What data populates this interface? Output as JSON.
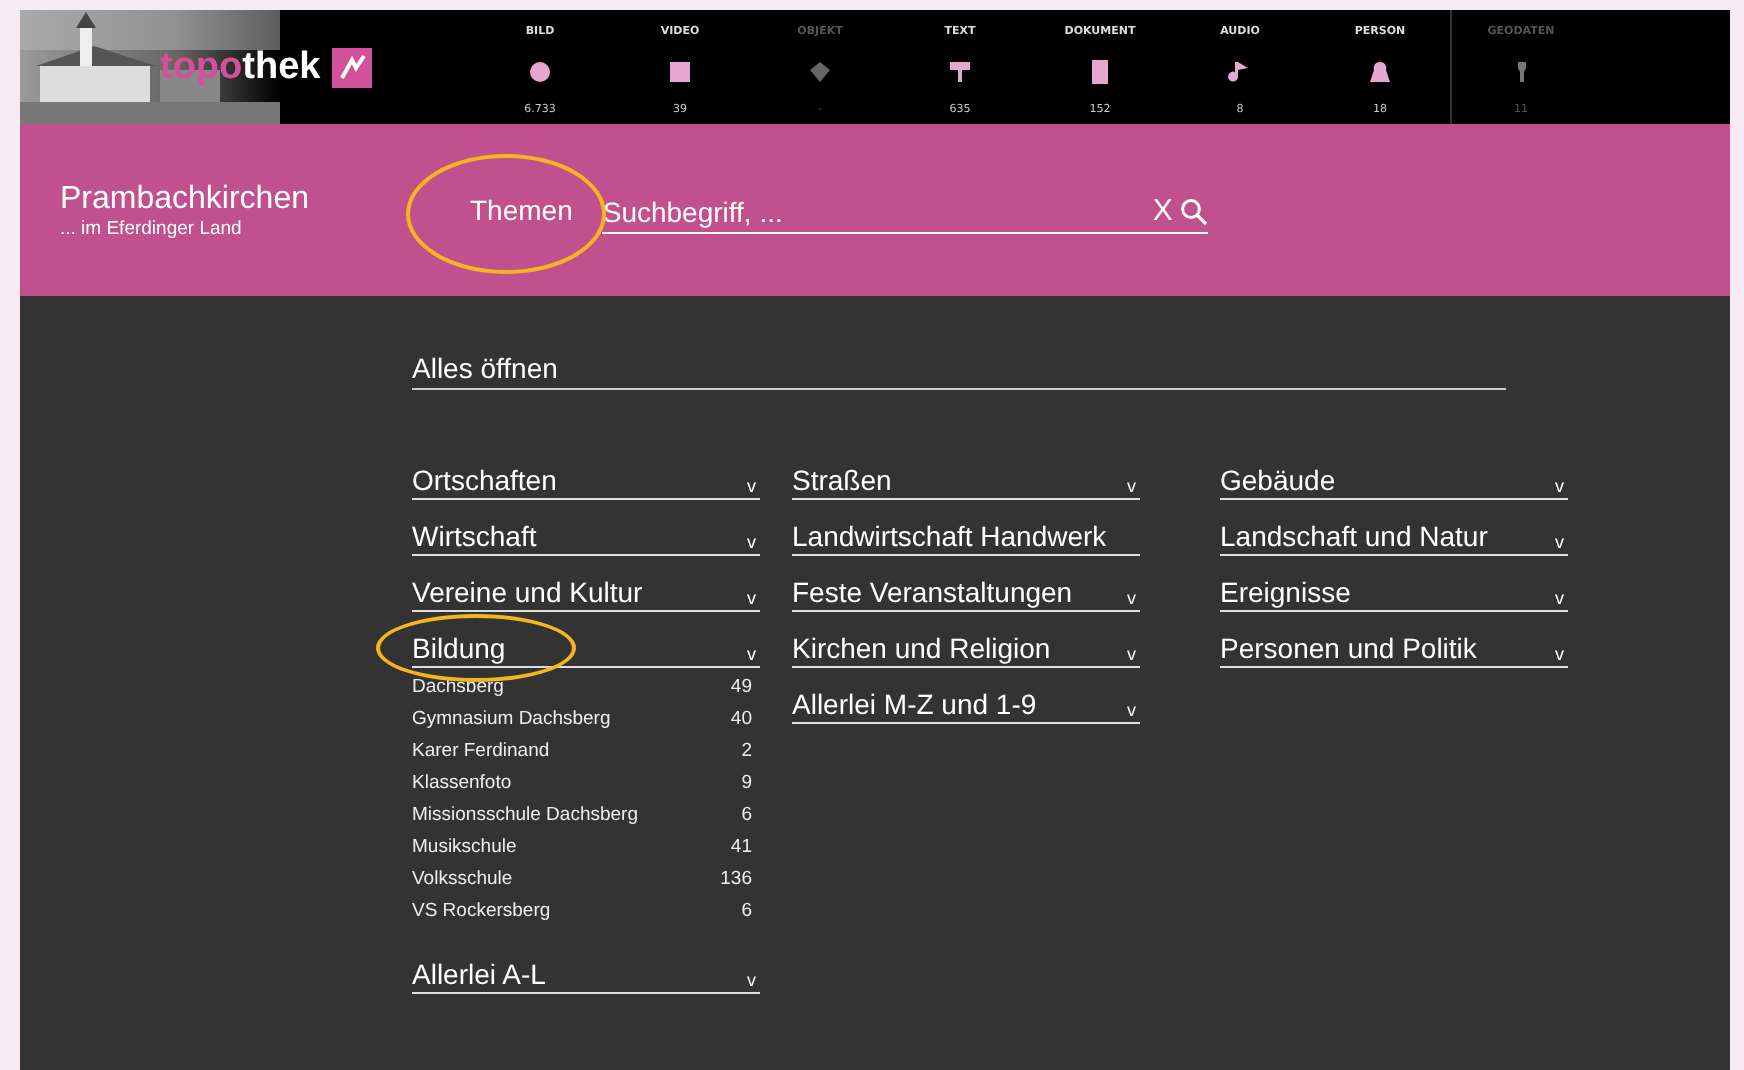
{
  "logo": {
    "part_1": "topo",
    "part_2": "thek"
  },
  "media_types": [
    {
      "label": "BILD",
      "count": "6.733",
      "disabled": false
    },
    {
      "label": "VIDEO",
      "count": "39",
      "disabled": false
    },
    {
      "label": "OBJEKT",
      "count": "-",
      "disabled": true
    },
    {
      "label": "TEXT",
      "count": "635",
      "disabled": false
    },
    {
      "label": "DOKUMENT",
      "count": "152",
      "disabled": false
    },
    {
      "label": "AUDIO",
      "count": "8",
      "disabled": false
    },
    {
      "label": "PERSON",
      "count": "18",
      "disabled": false
    },
    {
      "label": "GEODATEN",
      "count": "11",
      "disabled": true
    }
  ],
  "site": {
    "title": "Prambachkirchen",
    "subtitle": "... im Eferdinger Land"
  },
  "themes_button": {
    "label": "Themen",
    "highlighted": true
  },
  "search": {
    "placeholder": "Suchbegriff, ...",
    "clear": "X"
  },
  "open_all": "Alles öffnen",
  "columns": [
    [
      {
        "label": "Ortschaften",
        "toggle": "v",
        "expanded": false,
        "highlighted": false
      },
      {
        "label": "Wirtschaft",
        "toggle": "v",
        "expanded": false,
        "highlighted": false
      },
      {
        "label": "Vereine und Kultur",
        "toggle": "v",
        "expanded": false,
        "highlighted": false
      },
      {
        "label": "Bildung",
        "toggle": "v",
        "expanded": true,
        "highlighted": true,
        "children": [
          {
            "label": "Dachsberg",
            "count": "49"
          },
          {
            "label": "Gymnasium Dachsberg",
            "count": "40"
          },
          {
            "label": "Karer Ferdinand",
            "count": "2"
          },
          {
            "label": "Klassenfoto",
            "count": "9"
          },
          {
            "label": "Missionsschule Dachsberg",
            "count": "6"
          },
          {
            "label": "Musikschule",
            "count": "41"
          },
          {
            "label": "Volksschule",
            "count": "136"
          },
          {
            "label": "VS Rockersberg",
            "count": "6"
          }
        ]
      },
      {
        "label": "Allerlei A-L",
        "toggle": "v",
        "expanded": false,
        "highlighted": false
      }
    ],
    [
      {
        "label": "Straßen",
        "toggle": "v",
        "expanded": false,
        "highlighted": false
      },
      {
        "label": "Landwirtschaft Handwerk",
        "expanded": false,
        "highlighted": false
      },
      {
        "label": "Feste Veranstaltungen",
        "toggle": "v",
        "expanded": false,
        "highlighted": false
      },
      {
        "label": "Kirchen und Religion",
        "toggle": "v",
        "expanded": false,
        "highlighted": false
      },
      {
        "label": "Allerlei M-Z und 1-9",
        "toggle": "v",
        "expanded": false,
        "highlighted": false
      }
    ],
    [
      {
        "label": "Gebäude",
        "toggle": "v",
        "expanded": false,
        "highlighted": false
      },
      {
        "label": "Landschaft und Natur",
        "toggle": "v",
        "expanded": false,
        "highlighted": false
      },
      {
        "label": "Ereignisse",
        "toggle": "v",
        "expanded": false,
        "highlighted": false
      },
      {
        "label": "Personen und Politik",
        "toggle": "v",
        "expanded": false,
        "highlighted": false
      }
    ]
  ]
}
